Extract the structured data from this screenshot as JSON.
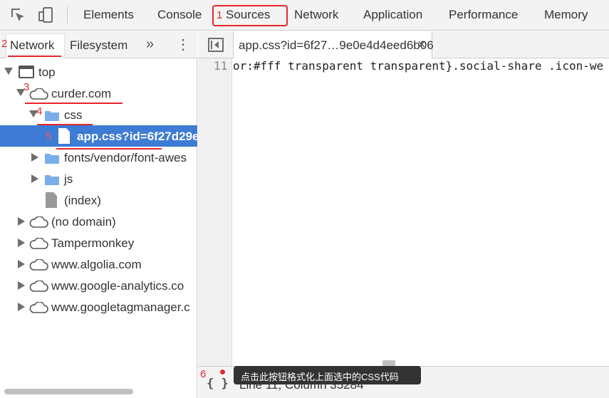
{
  "toolbar": {
    "tabs": [
      "Elements",
      "Console",
      "Sources",
      "Network",
      "Application",
      "Performance",
      "Memory"
    ],
    "active_tab": "Sources"
  },
  "navigator": {
    "tabs": [
      "Network",
      "Filesystem"
    ],
    "more": "»",
    "menu": "⋮",
    "tree": [
      {
        "label": "top",
        "icon": "frame-icon",
        "state": "expanded"
      },
      {
        "label": "curder.com",
        "icon": "cloud-icon",
        "state": "expanded"
      },
      {
        "label": "css",
        "icon": "folder-icon",
        "state": "expanded"
      },
      {
        "label": "app.css?id=6f27d29e",
        "icon": "file-icon",
        "state": "selected"
      },
      {
        "label": "fonts/vendor/font-awes",
        "icon": "folder-icon",
        "state": "collapsed"
      },
      {
        "label": "js",
        "icon": "folder-icon",
        "state": "collapsed"
      },
      {
        "label": "(index)",
        "icon": "document-icon",
        "state": "leaf"
      },
      {
        "label": "(no domain)",
        "icon": "cloud-icon",
        "state": "collapsed"
      },
      {
        "label": "Tampermonkey",
        "icon": "cloud-icon",
        "state": "collapsed"
      },
      {
        "label": "www.algolia.com",
        "icon": "cloud-icon",
        "state": "collapsed"
      },
      {
        "label": "www.google-analytics.co",
        "icon": "cloud-icon",
        "state": "collapsed"
      },
      {
        "label": "www.googletagmanager.c",
        "icon": "cloud-icon",
        "state": "collapsed"
      }
    ]
  },
  "editor": {
    "file_tab": "app.css?id=6f27…9e0e4d4eed6b06",
    "close": "×",
    "line_number": "11",
    "code": "or:#fff transparent transparent}.social-share .icon-we",
    "format_button": "{ }",
    "status": "Line 11, Column 35284",
    "tooltip": "点击此按钮格式化上面选中的CSS代码"
  },
  "annotations": [
    "1",
    "2",
    "3",
    "4",
    "5",
    "6"
  ],
  "colors": {
    "annotation": "#e8262a",
    "selection": "#3d7bd5",
    "folder": "#7aaee8"
  }
}
